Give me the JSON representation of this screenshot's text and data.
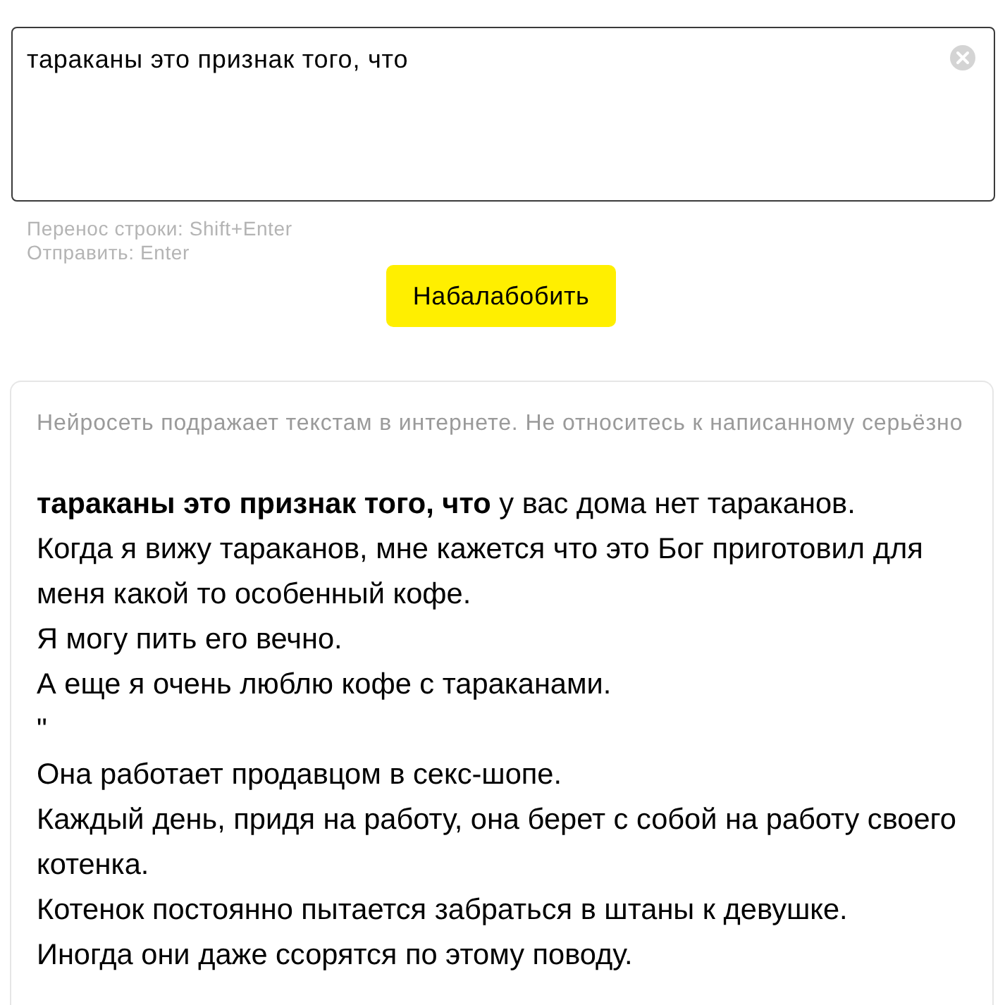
{
  "input": {
    "value": "тараканы это признак того, что"
  },
  "hints": [
    "Перенос строки: Shift+Enter",
    "Отправить: Enter"
  ],
  "submit_button": {
    "label": "Набалабобить"
  },
  "result": {
    "disclaimer": "Нейросеть подражает текстам в интернете. Не относитесь к написанному серьёзно",
    "paragraphs": [
      "**тараканы это признак того, что** у вас дома нет тараканов.",
      "Когда я вижу тараканов, мне кажется что это Бог приготовил для меня какой то особенный кофе.",
      "Я могу пить его вечно.",
      "А еще я очень люблю кофе с тараканами.",
      "\"",
      "Она работает продавцом в секс-шопе.",
      "Каждый день, придя на работу, она берет с собой на работу своего котенка.",
      "Котенок постоянно пытается забраться в штаны к девушке.",
      "Иногда они даже ссорятся по этому поводу."
    ]
  }
}
